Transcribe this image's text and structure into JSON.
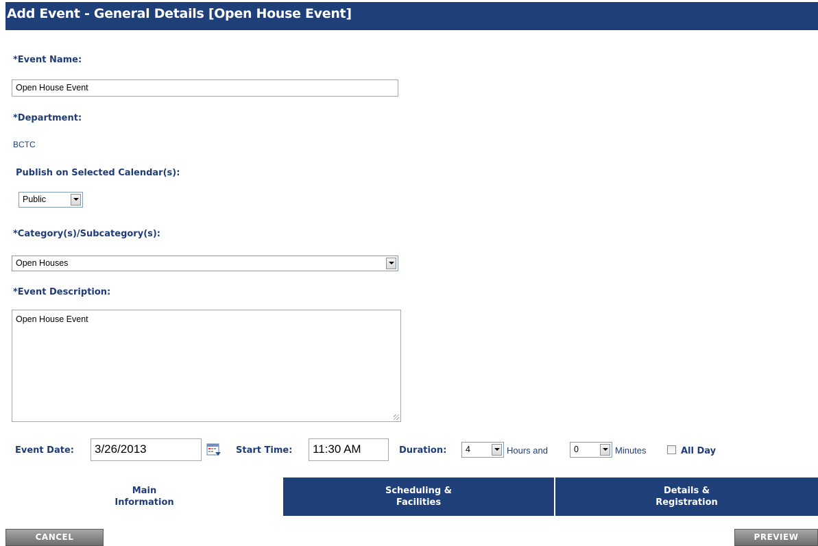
{
  "header": {
    "title": "Add Event - General Details [Open House Event]"
  },
  "form": {
    "event_name_label": "*Event Name:",
    "event_name_value": "Open House Event",
    "department_label": "*Department:",
    "department_value": "BCTC",
    "publish_label": "Publish on Selected Calendar(s):",
    "publish_value": "Public",
    "category_label": "*Category(s)/Subcategory(s):",
    "category_value": "Open Houses",
    "description_label": "*Event Description:",
    "description_value": "Open House Event",
    "event_date_label": "Event Date:",
    "event_date_value": "3/26/2013",
    "start_time_label": "Start Time:",
    "start_time_value": "11:30 AM",
    "duration_label": "Duration:",
    "duration_hours_value": "4",
    "hours_and_text": "Hours and",
    "duration_minutes_value": "0",
    "minutes_text": "Minutes",
    "all_day_label": "All Day",
    "all_day_checked": false
  },
  "tabs": [
    {
      "line1": "Main",
      "line2": "Information",
      "active": true
    },
    {
      "line1": "Scheduling &",
      "line2": "Facilities",
      "active": false
    },
    {
      "line1": "Details &",
      "line2": "Registration",
      "active": false
    }
  ],
  "buttons": {
    "cancel_label": "CANCEL",
    "preview_label": "PREVIEW"
  },
  "icons": {
    "calendar": "calendar-picker-icon",
    "dropdown": "chevron-down-icon"
  },
  "colors": {
    "brand_navy": "#1f3f78",
    "label_blue": "#1f3c78",
    "button_gray": "#8a8a8a"
  }
}
